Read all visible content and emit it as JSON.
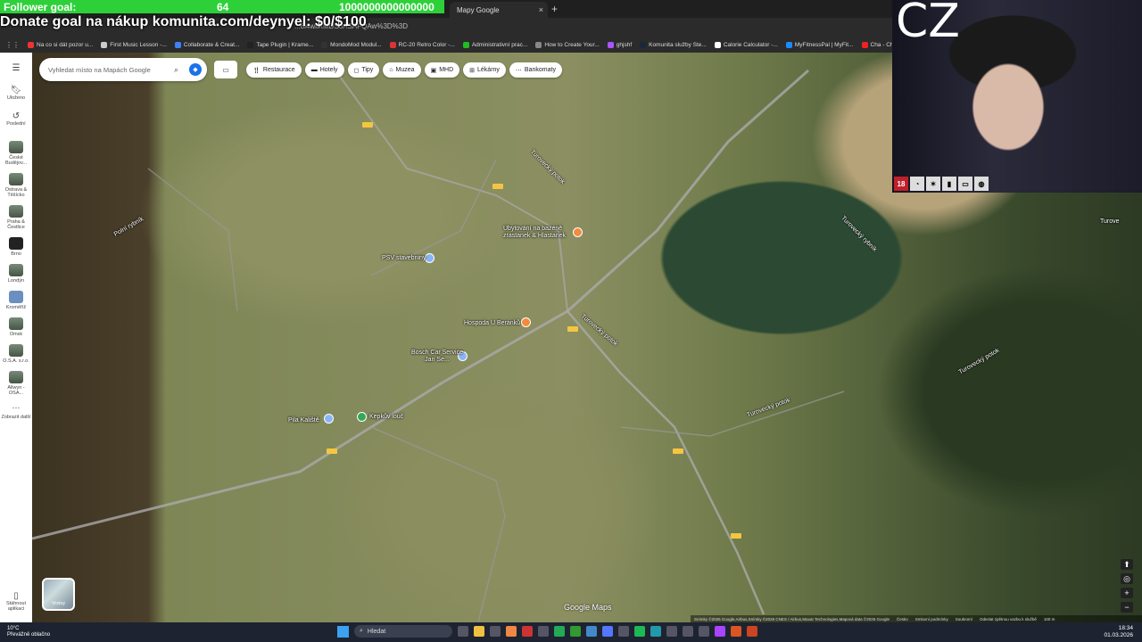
{
  "overlay": {
    "goal_label": "Follower goal:",
    "goal_current": "64",
    "goal_target": "1000000000000000",
    "donate_text": "Donate goal na nákup komunita.com/deynyel: $0/$100"
  },
  "browser": {
    "tab_title": "Mapy Google",
    "tab_close": "×",
    "new_tab": "+",
    "url_fragment": "...8i4wllXMDSoASAFQAw%3D%3D",
    "bookmarks": [
      "Na co si dát pozor u...",
      "First Music Lesson -...",
      "Collaborate & Creat...",
      "Tape Plugin | Krame...",
      "MondoMod Modul...",
      "RC-20 Retro Color -...",
      "Administrativní prac...",
      "How to Create Your...",
      "ghjshf",
      "Komunita služby Ste...",
      "Calorie Calculator -...",
      "MyFitnessPal | MyFit...",
      "Cha - Cha by Simon..."
    ]
  },
  "sidebar": {
    "menu_icon": "menu-icon",
    "saved_label": "Uloženo",
    "recent_label": "Poslední",
    "recents": [
      "České Budějov...",
      "Ostrava & Těšícko",
      "Praha & Čestlice",
      "Brno",
      "Londýn",
      "Kroměříž",
      "Omsk",
      "O.S.A. s.r.o.",
      "Allwyn - OSA...",
      "Zobrazit další"
    ],
    "download_label": "Stáhnout aplikaci"
  },
  "map": {
    "search_placeholder": "Vyhledat místo na Mapách Google",
    "chips": [
      "Restaurace",
      "Hotely",
      "Tipy",
      "Muzea",
      "MHD",
      "Lékárny",
      "Bankomaty"
    ],
    "labels": {
      "polni_rybnik": "Polní rybník",
      "psv": "PSV stavebniny",
      "ubytovani": "Ubytování na bazéně zrastanek & Hlastanek",
      "hospoda": "Hospoda U Beránků",
      "bosch": "Bosch Car Service Jan Se...",
      "pila": "Pila Kaliště",
      "kepkovo": "Kepkův louč",
      "turovecky1": "Turovecký potok",
      "turovecky2": "Turovecký potok",
      "turovecky3": "Turovecký potok",
      "turovecky4": "Turovecký potok",
      "turovecky_rybnik": "Turovecký rybník",
      "turove": "Turove"
    },
    "layers_tile_label": "Vrstvy",
    "brand": "Google Maps",
    "attribution": [
      "Snímky ©2026 Google,Airbus,Snímky ©2026 CNES / Airbus,Maxar Technologies,Mapová data ©2026 Google",
      "Česko",
      "Smluvní podmínky",
      "Soukromí",
      "Odeslat zpětnou vazbu k službě",
      "100 m"
    ]
  },
  "webcam": {
    "text": "CZ",
    "badge_18": "18"
  },
  "taskbar": {
    "temp": "10°C",
    "weather": "Převážně oblačno",
    "search": "Hledat",
    "time": "18:34",
    "date": "01.03.2026"
  },
  "colors": {
    "goal_bar": "#2ed03a",
    "maps_blue": "#1a73e8",
    "chrome_dark": "#2b2b2b"
  }
}
